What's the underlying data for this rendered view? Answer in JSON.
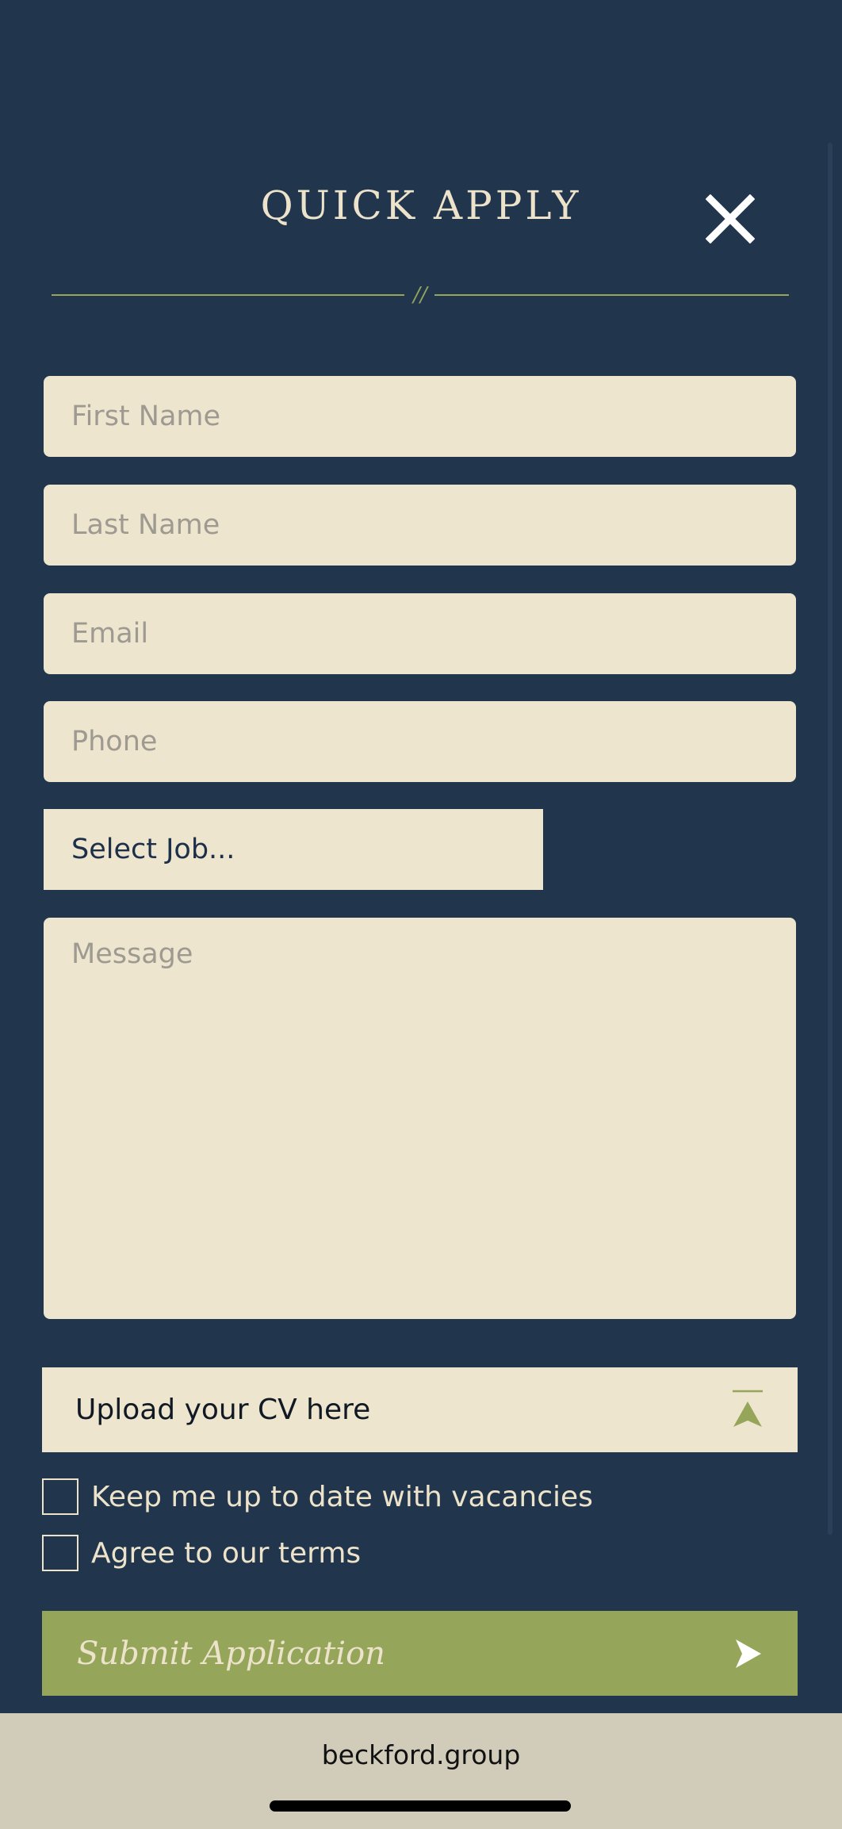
{
  "modal": {
    "title": "QUICK APPLY",
    "divider_glyph": "//"
  },
  "fields": {
    "first_name": {
      "placeholder": "First Name",
      "value": ""
    },
    "last_name": {
      "placeholder": "Last Name",
      "value": ""
    },
    "email": {
      "placeholder": "Email",
      "value": ""
    },
    "phone": {
      "placeholder": "Phone",
      "value": ""
    },
    "job_select": {
      "selected": "Select Job..."
    },
    "message": {
      "placeholder": "Message",
      "value": ""
    }
  },
  "upload": {
    "label": "Upload your CV here",
    "icon": "upload-icon"
  },
  "checkboxes": [
    {
      "label": "Keep me up to date with vacancies",
      "checked": false
    },
    {
      "label": "Agree to our terms",
      "checked": false
    }
  ],
  "submit": {
    "label": "Submit Application",
    "icon": "send-arrow-icon"
  },
  "browser": {
    "url": "beckford.group"
  },
  "colors": {
    "background": "#21364d",
    "field_bg": "#ede5cd",
    "accent_green": "#95a65b",
    "text_light": "#ede3cb",
    "footer_bg": "#d1ccba"
  }
}
